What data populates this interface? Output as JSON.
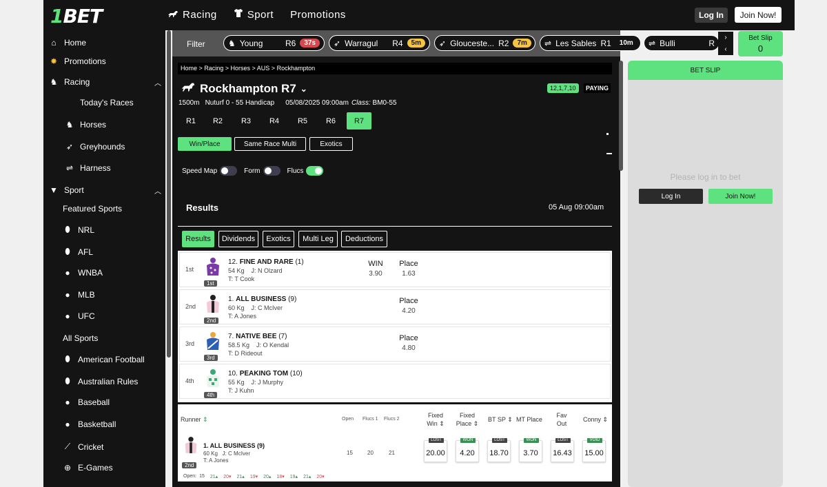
{
  "header": {
    "logo_one": "1",
    "logo_text": "BET",
    "nav": [
      {
        "label": "Racing",
        "icon": "horse-icon"
      },
      {
        "label": "Sport",
        "icon": "shirt-icon"
      },
      {
        "label": "Promotions",
        "icon": ""
      }
    ],
    "login_label": "Log In",
    "join_label": "Join Now!"
  },
  "sidebar": {
    "items": [
      {
        "label": "Home",
        "icon": "home-icon"
      },
      {
        "label": "Promotions",
        "icon": "promotions-icon"
      },
      {
        "label": "Racing",
        "icon": "horse-icon"
      },
      {
        "label": "Today's Races",
        "icon": ""
      },
      {
        "label": "Horses",
        "icon": "horse-icon"
      },
      {
        "label": "Greyhounds",
        "icon": "greyhound-icon"
      },
      {
        "label": "Harness",
        "icon": "harness-icon"
      },
      {
        "label": "Sport",
        "icon": "shirt-icon"
      },
      {
        "label": "Featured Sports",
        "icon": ""
      },
      {
        "label": "NRL",
        "icon": "rugby-ball-icon"
      },
      {
        "label": "AFL",
        "icon": "afl-ball-icon"
      },
      {
        "label": "WNBA",
        "icon": "basketball-icon"
      },
      {
        "label": "MLB",
        "icon": "baseball-icon"
      },
      {
        "label": "UFC",
        "icon": "glove-icon"
      },
      {
        "label": "All Sports",
        "icon": ""
      },
      {
        "label": "American Football",
        "icon": "football-icon"
      },
      {
        "label": "Australian Rules",
        "icon": "afl-ball-icon"
      },
      {
        "label": "Baseball",
        "icon": "baseball-icon"
      },
      {
        "label": "Basketball",
        "icon": "basketball-icon"
      },
      {
        "label": "Cricket",
        "icon": "cricket-icon"
      },
      {
        "label": "E-Games",
        "icon": "gamepad-icon"
      }
    ]
  },
  "filter": {
    "label": "Filter",
    "chips": [
      {
        "name": "Young",
        "race": "R6",
        "time": "37s",
        "badge": "red"
      },
      {
        "name": "Warragul",
        "race": "R4",
        "time": "5m",
        "badge": "yellow"
      },
      {
        "name": "Glouceste...",
        "race": "R2",
        "time": "7m",
        "badge": "yellow"
      },
      {
        "name": "Les Sables",
        "race": "R1",
        "time": "10m",
        "badge": "plain"
      },
      {
        "name": "Bulli",
        "race": "R",
        "time": "",
        "badge": "plain"
      }
    ]
  },
  "betslip_button": {
    "label": "Bet Slip",
    "count": "0"
  },
  "race": {
    "breadcrumb": "Home > Racing > Horses > AUS > Rockhampton",
    "title": "Rockhampton R7",
    "distance": "1500m",
    "track": "Nuturf 0 - 55 Handicap",
    "datetime": "05/08/2025 09:00am",
    "class_label": "Class:",
    "class_value": "BM0-55",
    "num_badge": "12,1,7,10",
    "status": "PAYING",
    "race_tabs": [
      "R1",
      "R2",
      "R3",
      "R4",
      "R5",
      "R6",
      "R7"
    ],
    "bet_tabs": [
      "Win/Place",
      "Same Race Multi",
      "Exotics"
    ],
    "toggles": [
      "Speed Map",
      "Form",
      "Flucs"
    ]
  },
  "results": {
    "title": "Results",
    "date": "05 Aug 09:00am",
    "tabs": [
      "Results",
      "Dividends",
      "Exotics",
      "Multi Leg",
      "Deductions"
    ],
    "rows": [
      {
        "pos": "1st",
        "silk_label": "1st",
        "name": "FINE AND RARE",
        "number": "12.",
        "barrier": "(1)",
        "weight": "54 Kg",
        "jockey": "J: N Olzard",
        "trainer": "T: T Cook",
        "win_head": "WIN",
        "win": "3.90",
        "place_head": "Place",
        "place": "1.63"
      },
      {
        "pos": "2nd",
        "silk_label": "2nd",
        "name": "ALL BUSINESS",
        "number": "1.",
        "barrier": "(9)",
        "weight": "60 Kg",
        "jockey": "J: C McIver",
        "trainer": "T: A Jones",
        "win_head": "",
        "win": "",
        "place_head": "Place",
        "place": "4.20"
      },
      {
        "pos": "3rd",
        "silk_label": "3rd",
        "name": "NATIVE BEE",
        "number": "7.",
        "barrier": "(7)",
        "weight": "58.5 Kg",
        "jockey": "J: O Kendal",
        "trainer": "T: D Rideout",
        "win_head": "",
        "win": "",
        "place_head": "Place",
        "place": "4.80"
      },
      {
        "pos": "4th",
        "silk_label": "4th",
        "name": "PEAKING TOM",
        "number": "10.",
        "barrier": "(10)",
        "weight": "55 Kg",
        "jockey": "J: J Murphy",
        "trainer": "T: J Kuhn",
        "win_head": "",
        "win": "",
        "place_head": "",
        "place": ""
      }
    ]
  },
  "runner_table": {
    "headers": {
      "runner": "Runner",
      "open": "Open",
      "flucs1": "Flucs 1",
      "flucs2": "Flucs 2",
      "fixed_win": "Fixed Win",
      "fixed_place": "Fixed Place",
      "bt_sp": "BT SP",
      "mt_place": "MT Place",
      "fav_out": "Fav Out",
      "conny": "Conny"
    },
    "row": {
      "name": "1. ALL BUSINESS (9)",
      "weight": "60 Kg",
      "jockey": "J: C McIver",
      "trainer": "T: A Jones",
      "silk_label": "2nd",
      "open": "15",
      "flucs1": "20",
      "flucs2": "21",
      "odds": [
        {
          "tag": "LOST",
          "value": "20.00",
          "kind": "lost"
        },
        {
          "tag": "WON",
          "value": "4.20",
          "kind": "won"
        },
        {
          "tag": "LOST",
          "value": "18.70",
          "kind": "lost"
        },
        {
          "tag": "WON",
          "value": "3.70",
          "kind": "won"
        },
        {
          "tag": "LOST",
          "value": "16.43",
          "kind": "lost"
        },
        {
          "tag": "VOID",
          "value": "15.00",
          "kind": "void"
        }
      ],
      "flucs_line": {
        "label": "Open:",
        "open": "15",
        "values": [
          {
            "v": "21",
            "dir": "up"
          },
          {
            "v": "20",
            "dir": "down"
          },
          {
            "v": "21",
            "dir": "up"
          },
          {
            "v": "19",
            "dir": "down"
          },
          {
            "v": "20",
            "dir": "up"
          },
          {
            "v": "18",
            "dir": "down"
          },
          {
            "v": "19",
            "dir": "up"
          },
          {
            "v": "21",
            "dir": "up"
          },
          {
            "v": "20",
            "dir": "down"
          }
        ]
      }
    }
  },
  "betslip_panel": {
    "title": "BET SLIP",
    "message": "Please log in to bet",
    "login_label": "Log In",
    "join_label": "Join Now!"
  },
  "colors": {
    "accent": "#5de27f",
    "dark": "#141414",
    "red": "#d9464b",
    "yellow": "#f5c541"
  }
}
